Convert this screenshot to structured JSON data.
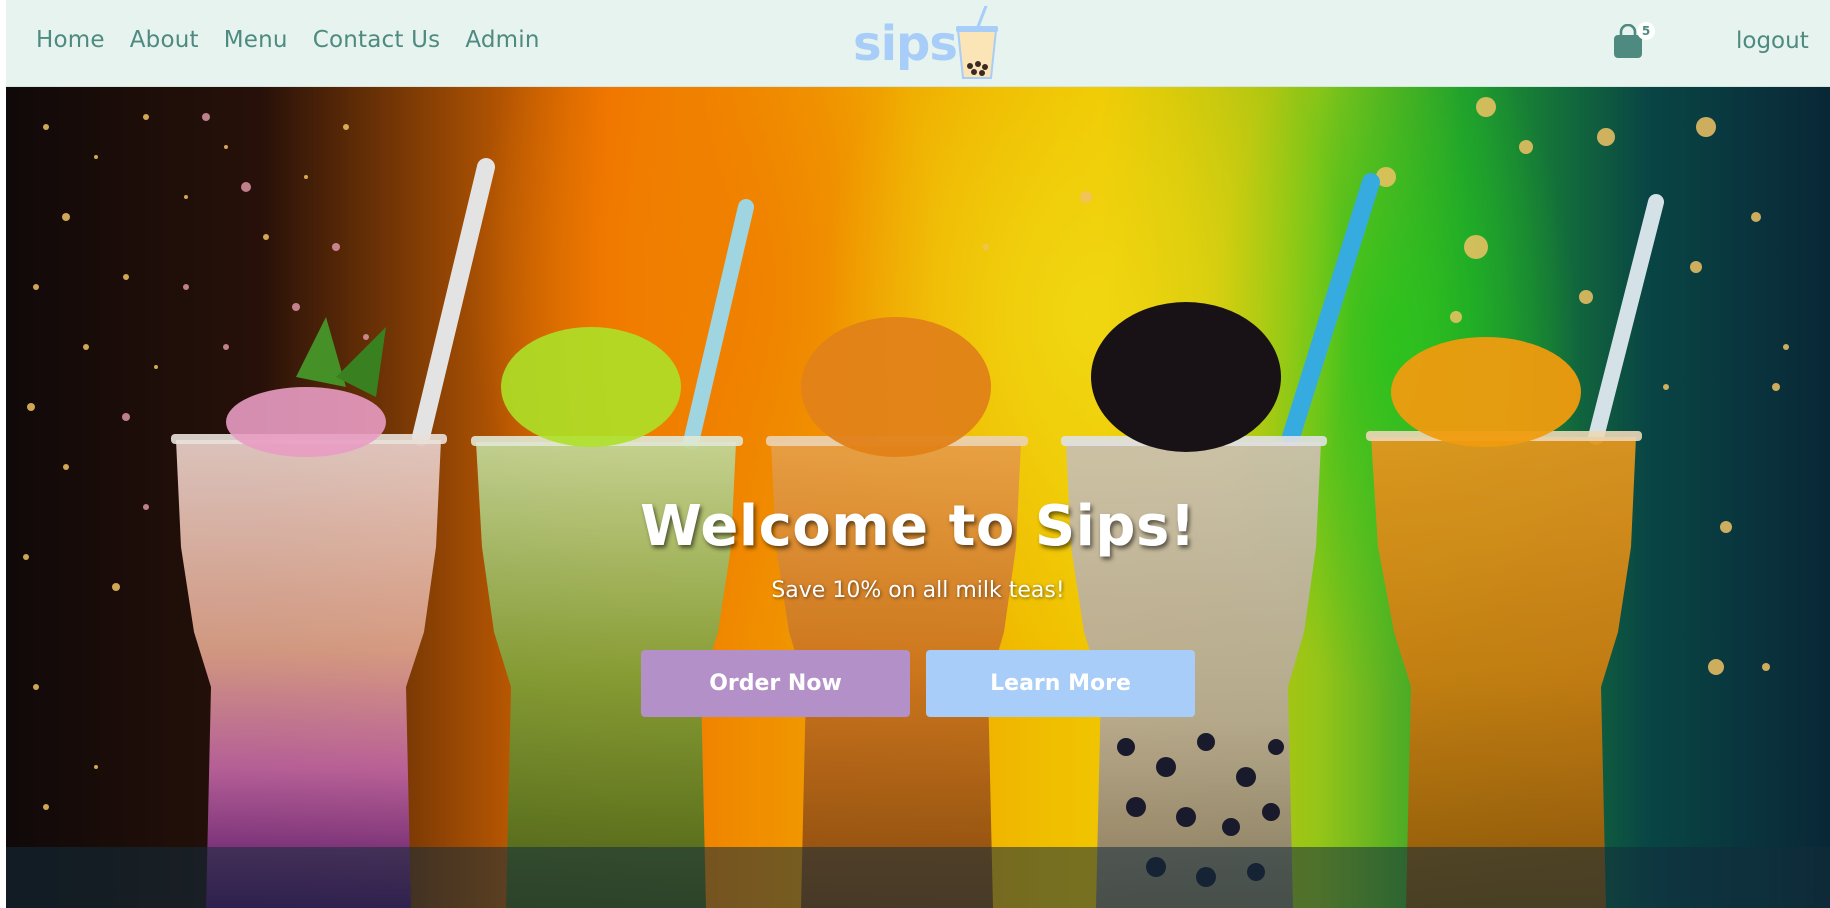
{
  "nav": {
    "links": [
      {
        "label": "Home"
      },
      {
        "label": "About"
      },
      {
        "label": "Menu"
      },
      {
        "label": "Contact Us"
      },
      {
        "label": "Admin"
      }
    ],
    "logo_text": "sips",
    "logo_icon": "boba-cup-icon",
    "cart_icon": "shopping-bag-icon",
    "cart_count": "5",
    "logout_label": "logout"
  },
  "hero": {
    "title": "Welcome to Sips!",
    "subtitle": "Save 10% on all milk teas!",
    "order_button_label": "Order Now",
    "learn_button_label": "Learn More",
    "background_image": "five colorful bubble tea drinks with straws on a rainbow background"
  },
  "colors": {
    "nav_background": "#e6f3ee",
    "nav_text": "#4e8a80",
    "logo": "#a7cdf8",
    "order_button": "#b390c8",
    "learn_button": "#a7cdf8",
    "cart_icon": "#4e8a80"
  }
}
